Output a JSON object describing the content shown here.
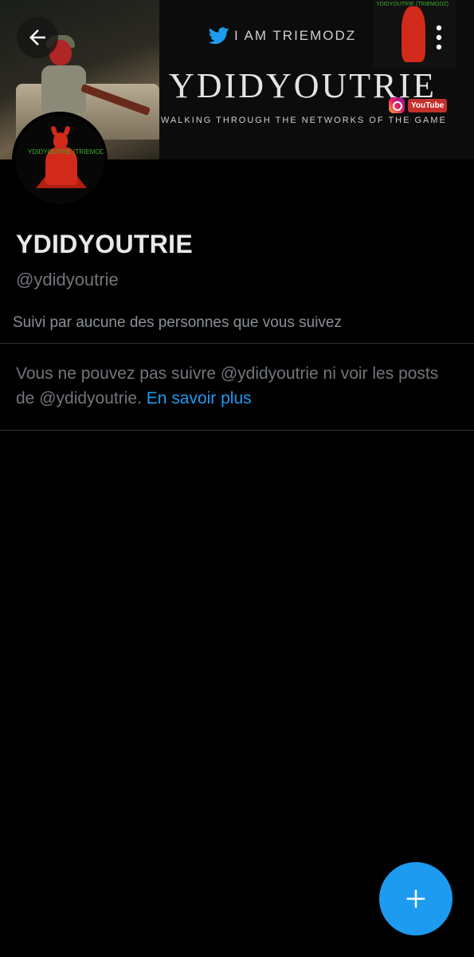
{
  "banner": {
    "tagline": "I AM TRIEMODZ",
    "title": "YDIDYOUTRIE",
    "subtitle": "WALKING THROUGH THE NETWORKS OF THE GAME",
    "youtube_label": "YouTube",
    "corner_text": "YDIDYOUTRIE (TRIEMODZ)"
  },
  "avatar": {
    "text": "YDIDYOUTRIE (TRIEMODZ)"
  },
  "profile": {
    "display_name": "YDIDYOUTRIE",
    "handle": "@ydidyoutrie",
    "followed_by": "Suivi par aucune des personnes que vous suivez"
  },
  "notice": {
    "text": "Vous ne pouvez pas suivre @ydidyoutrie ni voir les posts de @ydidyoutrie.",
    "link": "En savoir plus"
  },
  "icons": {
    "back": "back-arrow-icon",
    "more": "more-vertical-icon",
    "compose": "plus-icon",
    "twitter": "twitter-bird-icon"
  },
  "colors": {
    "accent": "#1d9bf0",
    "background": "#000000",
    "muted_text": "#71767b",
    "primary_text": "#e7e9ea"
  }
}
